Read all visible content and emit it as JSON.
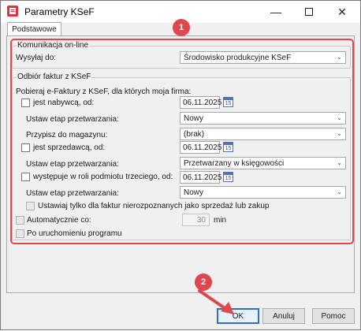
{
  "window": {
    "title": "Parametry KSeF"
  },
  "tabs": [
    {
      "label": "Podstawowe",
      "active": true
    }
  ],
  "group_online": {
    "legend": "Komunikacja on-line",
    "send_label": "Wysyłaj do:",
    "send_value": "Środowisko produkcyjne KSeF"
  },
  "group_receive": {
    "legend": "Odbiór faktur z KSeF",
    "intro": "Pobieraj e-Faktury z KSeF, dla których moja firma:",
    "buyer": {
      "label": "jest nabywcą, od:",
      "checked": false,
      "date": "06.11.2025",
      "stage_label": "Ustaw etap przetwarzania:",
      "stage_value": "Nowy",
      "warehouse_label": "Przypisz do magazynu:",
      "warehouse_value": "(brak)"
    },
    "seller": {
      "label": "jest sprzedawcą, od:",
      "checked": false,
      "date": "06.11.2025",
      "stage_label": "Ustaw etap przetwarzania:",
      "stage_value": "Przetwarzany w księgowości"
    },
    "third": {
      "label": "występuje w roli podmiotu trzeciego, od:",
      "checked": false,
      "date": "06.11.2025",
      "stage_label": "Ustaw etap przetwarzania:",
      "stage_value": "Nowy"
    },
    "unrecognized_label": "Ustawiaj tylko dla faktur nierozpoznanych jako sprzedaż lub zakup",
    "auto_label": "Automatycznie co:",
    "auto_value": "30",
    "auto_unit": "min",
    "startup_label": "Po uruchomieniu programu"
  },
  "calendar_day": "15",
  "buttons": {
    "ok": "OK",
    "cancel": "Anuluj",
    "help": "Pomoc"
  },
  "annotations": {
    "badge1": "1",
    "badge2": "2"
  },
  "colors": {
    "highlight": "#e0474c",
    "primary_border": "#2f6fc4"
  }
}
